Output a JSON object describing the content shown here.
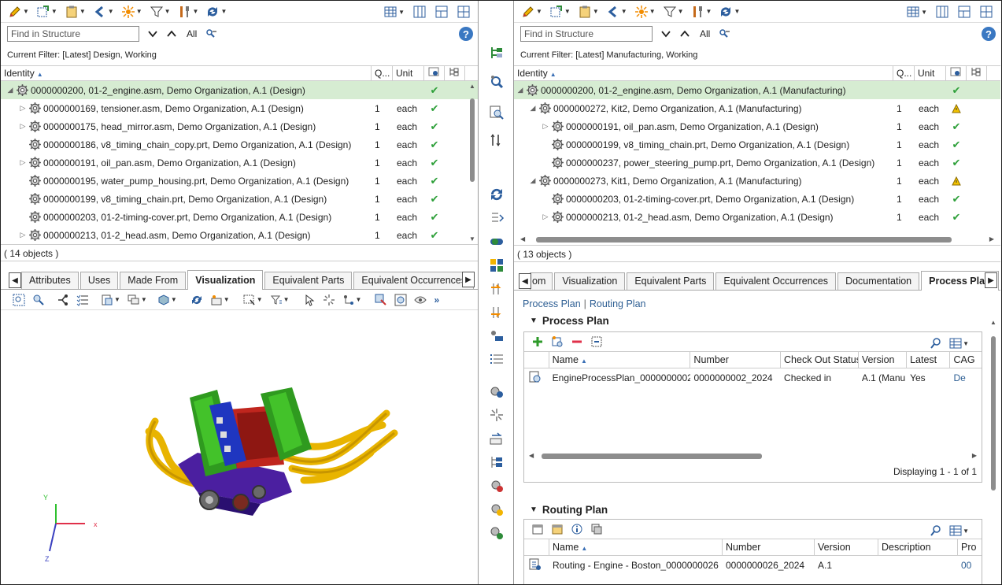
{
  "left": {
    "find_placeholder": "Find in Structure",
    "all_label": "All",
    "filter_text": "Current Filter: [Latest] Design, Working",
    "columns": {
      "identity": "Identity",
      "qty": "Q...",
      "unit": "Unit"
    },
    "rows": [
      {
        "label": "0000000200, 01-2_engine.asm, Demo Organization, A.1 (Design)",
        "qty": "",
        "unit": "",
        "status": "ok"
      },
      {
        "label": "0000000169, tensioner.asm, Demo Organization, A.1 (Design)",
        "qty": "1",
        "unit": "each",
        "status": "ok"
      },
      {
        "label": "0000000175, head_mirror.asm, Demo Organization, A.1 (Design)",
        "qty": "1",
        "unit": "each",
        "status": "ok"
      },
      {
        "label": "0000000186, v8_timing_chain_copy.prt, Demo Organization, A.1 (Design)",
        "qty": "1",
        "unit": "each",
        "status": "ok"
      },
      {
        "label": "0000000191, oil_pan.asm, Demo Organization, A.1 (Design)",
        "qty": "1",
        "unit": "each",
        "status": "ok"
      },
      {
        "label": "0000000195, water_pump_housing.prt, Demo Organization, A.1 (Design)",
        "qty": "1",
        "unit": "each",
        "status": "ok"
      },
      {
        "label": "0000000199, v8_timing_chain.prt, Demo Organization, A.1 (Design)",
        "qty": "1",
        "unit": "each",
        "status": "ok"
      },
      {
        "label": "0000000203, 01-2-timing-cover.prt, Demo Organization, A.1 (Design)",
        "qty": "1",
        "unit": "each",
        "status": "ok"
      },
      {
        "label": "0000000213, 01-2_head.asm, Demo Organization, A.1 (Design)",
        "qty": "1",
        "unit": "each",
        "status": "ok"
      }
    ],
    "count": "( 14 objects )",
    "tabs": [
      "Attributes",
      "Uses",
      "Made From",
      "Visualization",
      "Equivalent Parts",
      "Equivalent Occurrences"
    ],
    "active_tab": "Visualization",
    "axes": {
      "x": "x",
      "y": "Y",
      "z": "Z"
    }
  },
  "right": {
    "find_placeholder": "Find in Structure",
    "all_label": "All",
    "filter_text": "Current Filter: [Latest] Manufacturing, Working",
    "columns": {
      "identity": "Identity",
      "qty": "Q...",
      "unit": "Unit"
    },
    "rows": [
      {
        "label": "0000000200, 01-2_engine.asm, Demo Organization, A.1 (Manufacturing)",
        "qty": "",
        "unit": "",
        "status": "ok"
      },
      {
        "label": "0000000272, Kit2, Demo Organization, A.1 (Manufacturing)",
        "qty": "1",
        "unit": "each",
        "status": "warn"
      },
      {
        "label": "0000000191, oil_pan.asm, Demo Organization, A.1 (Design)",
        "qty": "1",
        "unit": "each",
        "status": "ok"
      },
      {
        "label": "0000000199, v8_timing_chain.prt, Demo Organization, A.1 (Design)",
        "qty": "1",
        "unit": "each",
        "status": "ok"
      },
      {
        "label": "0000000237, power_steering_pump.prt, Demo Organization, A.1 (Design)",
        "qty": "1",
        "unit": "each",
        "status": "ok"
      },
      {
        "label": "0000000273, Kit1, Demo Organization, A.1 (Manufacturing)",
        "qty": "1",
        "unit": "each",
        "status": "warn"
      },
      {
        "label": "0000000203, 01-2-timing-cover.prt, Demo Organization, A.1 (Design)",
        "qty": "1",
        "unit": "each",
        "status": "ok"
      },
      {
        "label": "0000000213, 01-2_head.asm, Demo Organization, A.1 (Design)",
        "qty": "1",
        "unit": "each",
        "status": "ok"
      }
    ],
    "count": "( 13 objects )",
    "tabs": [
      "om",
      "Visualization",
      "Equivalent Parts",
      "Equivalent Occurrences",
      "Documentation",
      "Process Plan"
    ],
    "active_tab": "Process Plan",
    "subnav": {
      "process": "Process Plan",
      "routing": "Routing Plan"
    },
    "process_plan": {
      "title": "Process Plan",
      "columns": [
        "Name",
        "Number",
        "Check Out Status",
        "Version",
        "Latest",
        "CAG"
      ],
      "row": {
        "name": "EngineProcessPlan_0000000002",
        "number": "0000000002_2024",
        "status": "Checked in",
        "version": "A.1 (Manu",
        "latest": "Yes",
        "cag": "De"
      },
      "displaying": "Displaying 1 - 1 of 1"
    },
    "routing_plan": {
      "title": "Routing Plan",
      "columns": [
        "Name",
        "Number",
        "Version",
        "Description",
        "Pro"
      ],
      "row": {
        "name": "Routing - Engine - Boston_0000000026",
        "number": "0000000026_2024",
        "version": "A.1",
        "description": "",
        "pro": "00"
      }
    }
  },
  "colors": {
    "ok": "#2ea03a",
    "warn": "#f2c200",
    "link": "#2d5e93",
    "selected_row": "#d6ecd2"
  }
}
